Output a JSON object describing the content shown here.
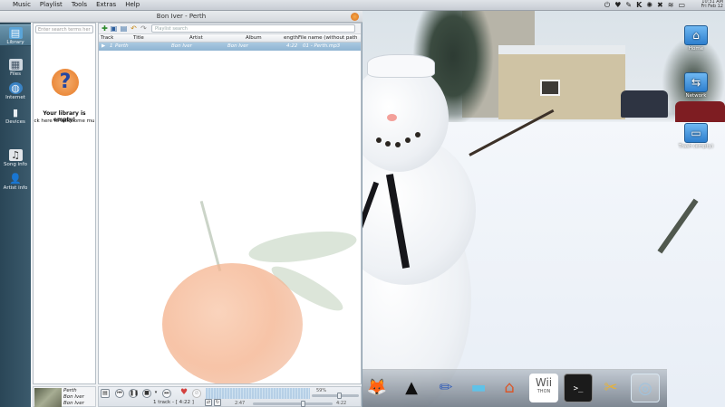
{
  "top_panel": {
    "menus": [
      "Music",
      "Playlist",
      "Tools",
      "Extras",
      "Help"
    ],
    "tray_icons": [
      "power-icon",
      "heart-icon",
      "pen-icon",
      "k-icon",
      "swirl-icon",
      "close-x-icon",
      "wifi-icon",
      "battery-icon"
    ],
    "clock_lines": [
      "10:31 AM",
      "Fri Feb 12"
    ]
  },
  "player": {
    "title": "Bon Iver - Perth",
    "sidebar": [
      {
        "label": "Library",
        "icon": "library-icon",
        "active": true
      },
      {
        "label": "Files",
        "icon": "files-icon",
        "active": false
      },
      {
        "label": "Internet",
        "icon": "internet-icon",
        "active": false
      },
      {
        "label": "Devices",
        "icon": "devices-icon",
        "active": false
      },
      {
        "label": "Song info",
        "icon": "song-info-icon",
        "active": false
      },
      {
        "label": "Artist info",
        "icon": "artist-info-icon",
        "active": false
      }
    ],
    "library": {
      "search_placeholder": "Enter search terms her",
      "empty_title": "Your library is empty!",
      "empty_hint": "ck here to add some mu"
    },
    "playlist": {
      "search_placeholder": "Playlist search",
      "columns": [
        "Track",
        "Title",
        "Artist",
        "Album",
        "ength",
        "File name (without path"
      ],
      "rows": [
        {
          "track": "1",
          "title": "Perth",
          "artist": "Bon Iver",
          "album": "Bon Iver",
          "length": "4:22",
          "filename": "01 - Perth.mp3"
        }
      ]
    },
    "now_playing": {
      "title": "Perth",
      "artist": "Bon Iver",
      "album": "Bon Iver"
    },
    "controls": {
      "status": "1 track - [ 4:22 ]",
      "elapsed": "2:47",
      "total": "4:22",
      "volume_label": "59%",
      "volume_fraction": 0.59,
      "seek_fraction": 0.64
    }
  },
  "desktop": {
    "icons": [
      {
        "label": "Home",
        "icon": "home-folder-icon"
      },
      {
        "label": "Network",
        "icon": "network-icon"
      },
      {
        "label": "Trash (empty)",
        "icon": "trash-icon"
      }
    ]
  },
  "dock": {
    "items": [
      "gimp-icon",
      "inkscape-icon",
      "pencil-icon",
      "scanner-icon",
      "house-app-icon",
      "wiithon-icon",
      "terminal-icon",
      "settings-tools-icon",
      "cube-switcher-icon"
    ],
    "wii_text": "Wii",
    "wii_sub": "THON"
  }
}
